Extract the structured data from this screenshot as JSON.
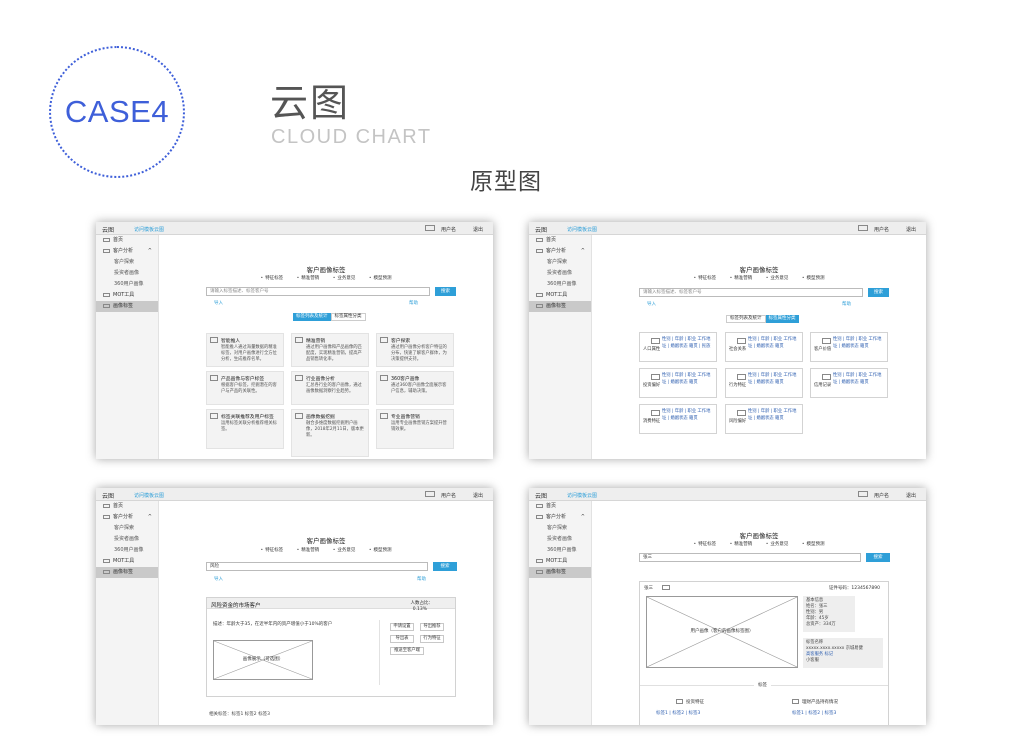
{
  "header": {
    "badge": "CASE4",
    "title_cn": "云图",
    "title_en": "CLOUD CHART",
    "subtitle": "原型图"
  },
  "colors": {
    "accent_blue": "#3e5fd9",
    "ui_blue": "#2e9fd8"
  },
  "app": {
    "logo": "云图",
    "subnav": "访问模板云图",
    "user": "用户名",
    "logout": "退出",
    "sidebar": [
      {
        "label": "首页",
        "icon": "home-icon"
      },
      {
        "label": "客户分析",
        "icon": "analysis-icon"
      },
      {
        "label": "客户探索"
      },
      {
        "label": "投资者画像"
      },
      {
        "label": "360用户画像"
      },
      {
        "label": "MOT工具",
        "icon": "tool-icon"
      },
      {
        "label": "画像标签",
        "icon": "tag-icon"
      }
    ],
    "page_title": "客户画像标签",
    "options": [
      "特征标签",
      "精准营销",
      "业务意见",
      "模型预测"
    ],
    "search_placeholder": "请输入标签描述、标签客户号",
    "search_button": "搜索",
    "link_import": "导入",
    "link_help": "帮助",
    "toggle_on": "标签列表及统计",
    "toggle_off": "标签属性分类"
  },
  "panel1": {
    "cards": [
      {
        "title": "智能推人",
        "desc": "智能推人通过海量数据的精准标签，对用户画像进行全方位分析，生成推荐名单。"
      },
      {
        "title": "精准营销",
        "desc": "通过用户画像和产品画像的匹配度，实现精准营销，提高产品销售转化率。"
      },
      {
        "title": "客户探索",
        "desc": "通过用户画像分析客户特征的分布，快速了解客户群体，为决策提供支持。"
      },
      {
        "title": "产品画像与客户标签",
        "desc": "根据客户标签，挖掘潜在的客户与产品的关联性。"
      },
      {
        "title": "行业画像分析",
        "desc": "汇总各行业的客户画像，通过画像数据洞察行业趋势。"
      },
      {
        "title": "360客户画像",
        "desc": "通过360客户画像全面展示客户信息，辅助决策。"
      },
      {
        "title": "标签关联推荐及用户标签",
        "desc": "运用标签关联分析推荐相关标签。"
      },
      {
        "title": "画像数据挖掘",
        "desc": "融合多维度数据挖掘用户画像，2018年2月11日，版本更新。"
      },
      {
        "title": "专业画像营销",
        "desc": "运用专业画像营销方案提升营销效果。"
      }
    ]
  },
  "panel2": {
    "tags": [
      {
        "label": "人口属性",
        "values": "性别 | 年龄 | 职业 工作地址 | 婚姻状态 籍贯 | 民族"
      },
      {
        "label": "社会关系",
        "values": "性别 | 年龄 | 职业 工作地址 | 婚姻状态 籍贯"
      },
      {
        "label": "客户价值",
        "values": "性别 | 年龄 | 职业 工作地址 | 婚姻状态 籍贯"
      },
      {
        "label": "投资偏好",
        "values": "性别 | 年龄 | 职业 工作地址 | 婚姻状态 籍贯"
      },
      {
        "label": "行为特征",
        "values": "性别 | 年龄 | 职业 工作地址 | 婚姻状态 籍贯"
      },
      {
        "label": "信用记录",
        "values": "性别 | 年龄 | 职业 工作地址 | 婚姻状态 籍贯"
      },
      {
        "label": "消费特征",
        "values": "性别 | 年龄 | 职业 工作地址 | 婚姻状态 籍贯"
      },
      {
        "label": "风险偏好",
        "values": "性别 | 年龄 | 职业 工作地址 | 婚姻状态 籍贯"
      }
    ]
  },
  "panel3": {
    "search_value": "风险",
    "result_title": "风险资金的市场客户",
    "ratio_label": "人数占比：",
    "ratio_value": "0.13%",
    "desc": "描述：年龄大于35，在近半年内的资产增值小于10%的客户",
    "chart_label": "画像展示（可选图）",
    "buttons": [
      "申请设置",
      "导出推荐",
      "导出表",
      "行为特征",
      "推送至客户端"
    ],
    "footer": "相关标签：标签1 标签2 标签3"
  },
  "panel4": {
    "search_value": "张三",
    "customer_name": "张三",
    "customer_id": "证件号码：1234567890",
    "profile_label": "用户画像（客户的画像标签图）",
    "basic_title": "基本信息",
    "basic_lines": [
      "姓名：张三",
      "性别：男",
      "年龄：45岁",
      "总资产：334万"
    ],
    "contact_title": "标签名称",
    "contact_lines": [
      "xxxxx.xxxx.xxxxx 京城易健",
      "高客服务  标记",
      "小客服"
    ],
    "section_label": "标签",
    "sub_left": "投资特征",
    "sub_right": "理财产品持有情况",
    "sub_left_values": "标签1 | 标签2 | 标签3",
    "sub_right_values": "标签1 | 标签2 | 标签3"
  }
}
